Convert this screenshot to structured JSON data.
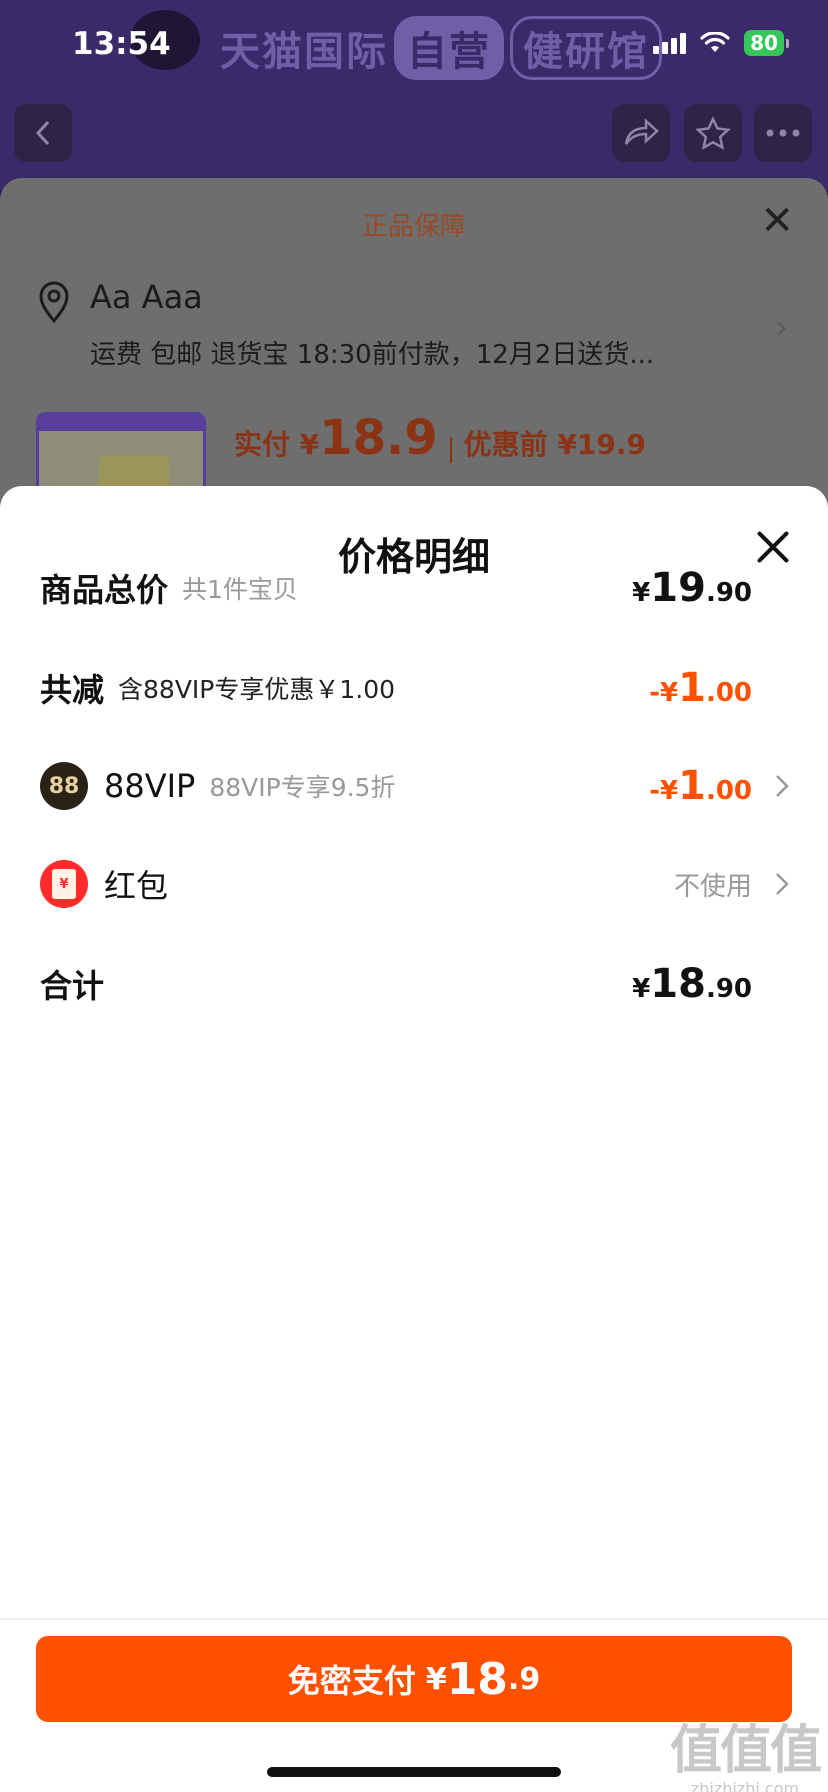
{
  "status_bar": {
    "time": "13:54",
    "battery": "80"
  },
  "banner": {
    "text": "天猫国际",
    "badge1": "自营",
    "badge2": "健研馆"
  },
  "background_sheet": {
    "title": "正品保障",
    "address_name": "Aa Aaa",
    "delivery_info": "运费 包邮 退货宝 18:30前付款，12月2日送货...",
    "paid_label": "实付 ¥",
    "paid_amount": "18.9",
    "before_discount": "优惠前 ¥19.9"
  },
  "sheet": {
    "title": "价格明细",
    "rows": [
      {
        "label": "商品总价",
        "sub": "共1件宝贝",
        "currency": "¥",
        "int": "19",
        "dec": ".90"
      },
      {
        "label": "共减",
        "sub": "含88VIP专享优惠￥1.00",
        "currency": "-¥",
        "int": "1",
        "dec": ".00"
      },
      {
        "label": "88VIP",
        "sub": "88VIP专享9.5折",
        "icon_text": "88",
        "currency": "-¥",
        "int": "1",
        "dec": ".00"
      },
      {
        "label": "红包",
        "icon_text": "¥",
        "value": "不使用"
      },
      {
        "label": "合计",
        "currency": "¥",
        "int": "18",
        "dec": ".90"
      }
    ]
  },
  "pay_button": {
    "label": "免密支付",
    "currency": "¥",
    "int": "18",
    "dec": ".9"
  },
  "watermark": {
    "big": "值值值",
    "small": "zhizhizhi.com"
  },
  "colors": {
    "accent": "#ff5000",
    "vip_dark": "#2a2117",
    "red_packet": "#ff2a2a"
  }
}
